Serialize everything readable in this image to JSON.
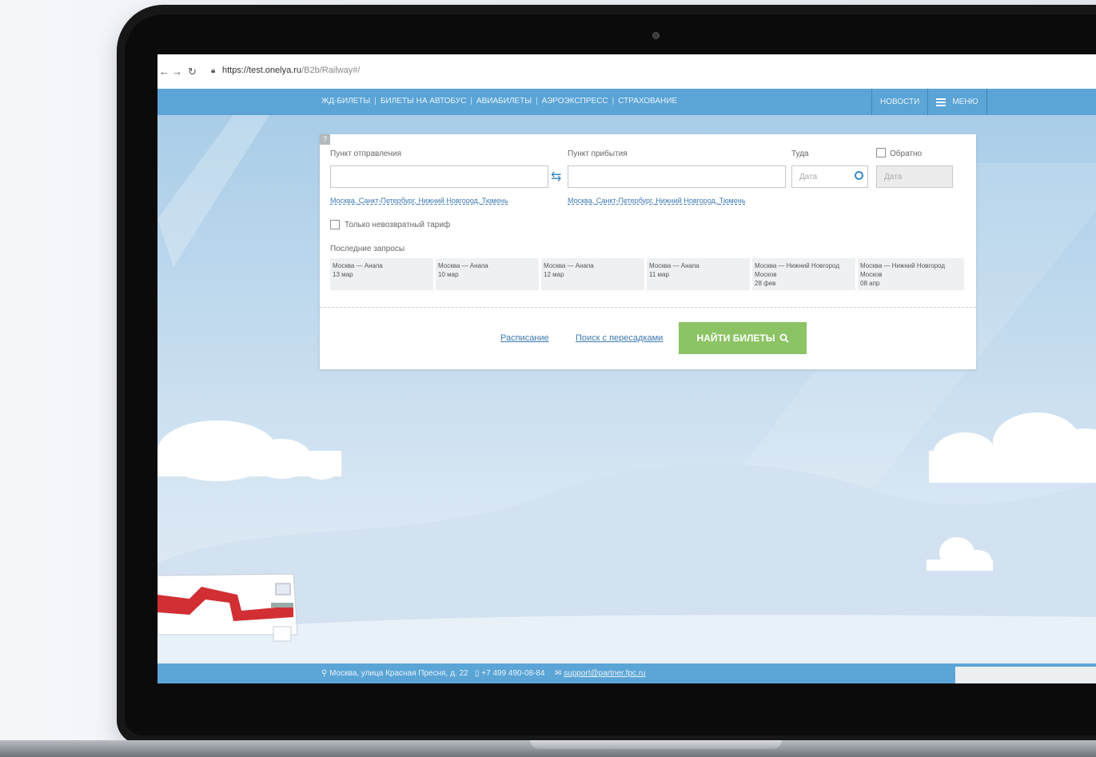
{
  "browser": {
    "url_domain": "https://test.onelya.ru",
    "url_path": "/B2b/Railway#/"
  },
  "topnav": {
    "links": [
      "ЖД-БИЛЕТЫ",
      "БИЛЕТЫ НА АВТОБУС",
      "АВИАБИЛЕТЫ",
      "АЭРОЭКСПРЕСС",
      "СТРАХОВАНИЕ"
    ],
    "news": "НОВОСТИ",
    "menu": "МЕНЮ"
  },
  "search": {
    "help": "?",
    "from_label": "Пункт отправления",
    "to_label": "Пункт прибытия",
    "there_label": "Туда",
    "back_label": "Обратно",
    "date_placeholder": "Дата",
    "from_suggestions": [
      "Москва",
      "Санкт-Петербург",
      "Нижний Новгород",
      "Тюмень"
    ],
    "to_suggestions": [
      "Москва",
      "Санкт-Петербург",
      "Нижний Новгород",
      "Тюмень"
    ],
    "nonrefundable_label": "Только невозвратный тариф",
    "recent_label": "Последние запросы",
    "recent": [
      {
        "route": "Москва — Анапа",
        "line2": "13 мар",
        "line3": ""
      },
      {
        "route": "Москва — Анапа",
        "line2": "10 мар",
        "line3": ""
      },
      {
        "route": "Москва — Анапа",
        "line2": "12 мар",
        "line3": ""
      },
      {
        "route": "Москва — Анапа",
        "line2": "11 мар",
        "line3": ""
      },
      {
        "route": "Москва — Нижний Новгород",
        "line2": "Москов",
        "line3": "28 фев"
      },
      {
        "route": "Москва — Нижний Новгород",
        "line2": "Москов",
        "line3": "08 апр"
      }
    ],
    "schedule_link": "Расписание",
    "transfers_link": "Поиск с пересадками",
    "find_button": "НАЙТИ БИЛЕТЫ"
  },
  "footer": {
    "address": "Москва, улица Красная Пресня, д. 22",
    "phone": "+7 499 490-08-84",
    "email": "support@partner.fpc.ru"
  },
  "colors": {
    "nav_blue": "#5aa4d6",
    "button_green": "#8cc365",
    "link_blue": "#3c79b3"
  }
}
